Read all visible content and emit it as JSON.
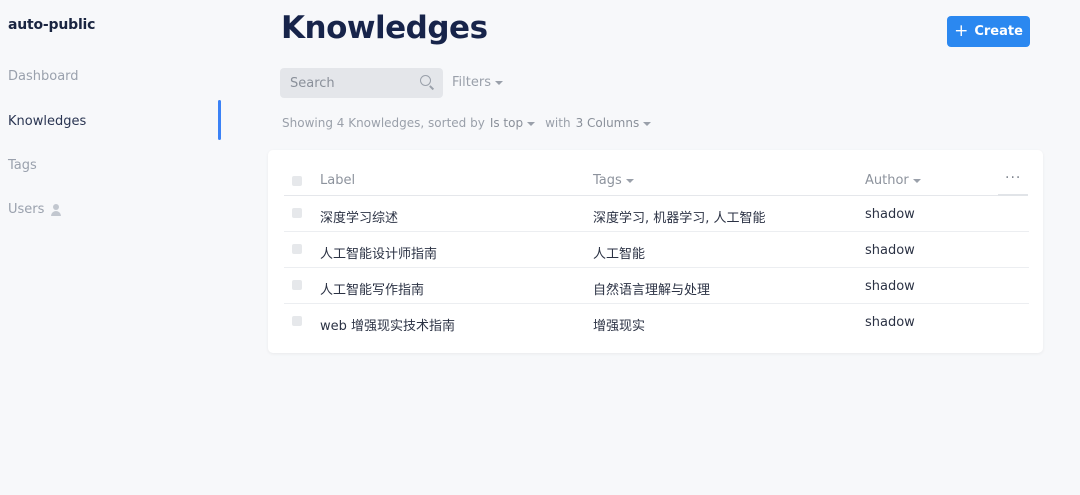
{
  "app": {
    "title": "auto-public"
  },
  "sidebar": {
    "items": [
      {
        "label": "Dashboard"
      },
      {
        "label": "Knowledges"
      },
      {
        "label": "Tags"
      },
      {
        "label": "Users"
      }
    ],
    "active_index": 1
  },
  "header": {
    "title": "Knowledges",
    "create_label": "Create"
  },
  "toolbar": {
    "search_placeholder": "Search",
    "filters_label": "Filters"
  },
  "summary": {
    "showing": "Showing 4 Knowledges, sorted by",
    "sort_by": "Is top",
    "with": "with",
    "columns": "3 Columns"
  },
  "table": {
    "columns": [
      "Label",
      "Tags",
      "Author"
    ],
    "more_label": "···",
    "rows": [
      {
        "label": "深度学习综述",
        "tags": "深度学习, 机器学习, 人工智能",
        "author": "shadow"
      },
      {
        "label": "人工智能设计师指南",
        "tags": "人工智能",
        "author": "shadow"
      },
      {
        "label": "人工智能写作指南",
        "tags": "自然语言理解与处理",
        "author": "shadow"
      },
      {
        "label": "web 增强现实技术指南",
        "tags": "增强现实",
        "author": "shadow"
      }
    ]
  },
  "colors": {
    "accent": "#2b88f0",
    "title": "#17244a",
    "background": "#f7f8fa"
  }
}
